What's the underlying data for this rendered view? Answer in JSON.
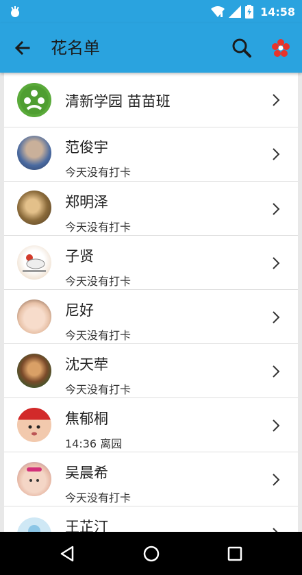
{
  "status_bar": {
    "time": "14:58"
  },
  "app_bar": {
    "title": "花名单",
    "accent_color": "#2aa3df"
  },
  "list": {
    "group": {
      "name": "清新学园 苗苗班"
    },
    "students": [
      {
        "name": "范俊宇",
        "status": "今天没有打卡"
      },
      {
        "name": "郑明泽",
        "status": "今天没有打卡"
      },
      {
        "name": "子贤",
        "status": "今天没有打卡"
      },
      {
        "name": "尼好",
        "status": "今天没有打卡"
      },
      {
        "name": "沈天荦",
        "status": "今天没有打卡"
      },
      {
        "name": "焦郁桐",
        "status": "14:36   离园"
      },
      {
        "name": "吴晨希",
        "status": "今天没有打卡"
      },
      {
        "name": "王芷汀",
        "status": ""
      }
    ]
  }
}
